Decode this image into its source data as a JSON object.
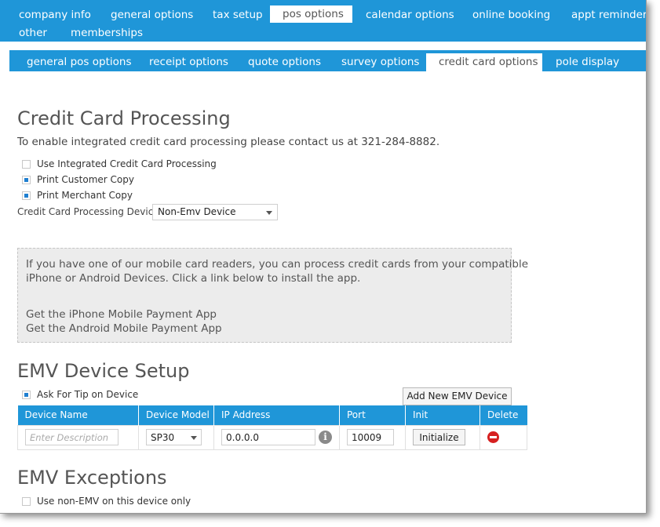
{
  "top_tabs": [
    {
      "label": "company info"
    },
    {
      "label": "general options"
    },
    {
      "label": "tax setup"
    },
    {
      "label": "pos options",
      "active": true
    },
    {
      "label": "calendar options"
    },
    {
      "label": "online booking"
    },
    {
      "label": "appt reminder"
    },
    {
      "label": "other"
    },
    {
      "label": "memberships"
    }
  ],
  "sub_tabs": [
    {
      "label": "general pos options"
    },
    {
      "label": "receipt options"
    },
    {
      "label": "quote options"
    },
    {
      "label": "survey options"
    },
    {
      "label": "credit card options",
      "active": true
    },
    {
      "label": "pole display"
    }
  ],
  "ccp": {
    "title": "Credit Card Processing",
    "intro": "To enable integrated credit card processing please contact us at 321-284-8882.",
    "options": [
      {
        "label": "Use Integrated Credit Card Processing",
        "checked": false
      },
      {
        "label": "Print Customer Copy",
        "checked": true
      },
      {
        "label": "Print Merchant Copy",
        "checked": true
      }
    ],
    "device_label": "Credit Card Processing Device",
    "device_value": "Non-Emv Device"
  },
  "mobile": {
    "line1": "If you have one of our mobile card readers, you can process credit cards from your compatible",
    "line2": "iPhone or Android Devices. Click a link below to install the app.",
    "iphone_link": "Get the iPhone Mobile Payment App",
    "android_link": "Get the Android Mobile Payment App"
  },
  "emv": {
    "title": "EMV Device Setup",
    "tip_label": "Ask For Tip on Device",
    "tip_checked": true,
    "add_button": "Add New EMV Device",
    "columns": [
      "Device Name",
      "Device Model",
      "IP Address",
      "Port",
      "Init",
      "Delete"
    ],
    "row": {
      "name_placeholder": "Enter Description",
      "model": "SP30",
      "ip": "0.0.0.0",
      "port": "10009",
      "init_button": "Initialize"
    }
  },
  "exceptions": {
    "title": "EMV Exceptions",
    "option_label": "Use non-EMV on this device only",
    "checked": false
  },
  "colors": {
    "accent": "#1f96d8",
    "delete": "#d62020",
    "checkbox": "#1f7fd0"
  }
}
